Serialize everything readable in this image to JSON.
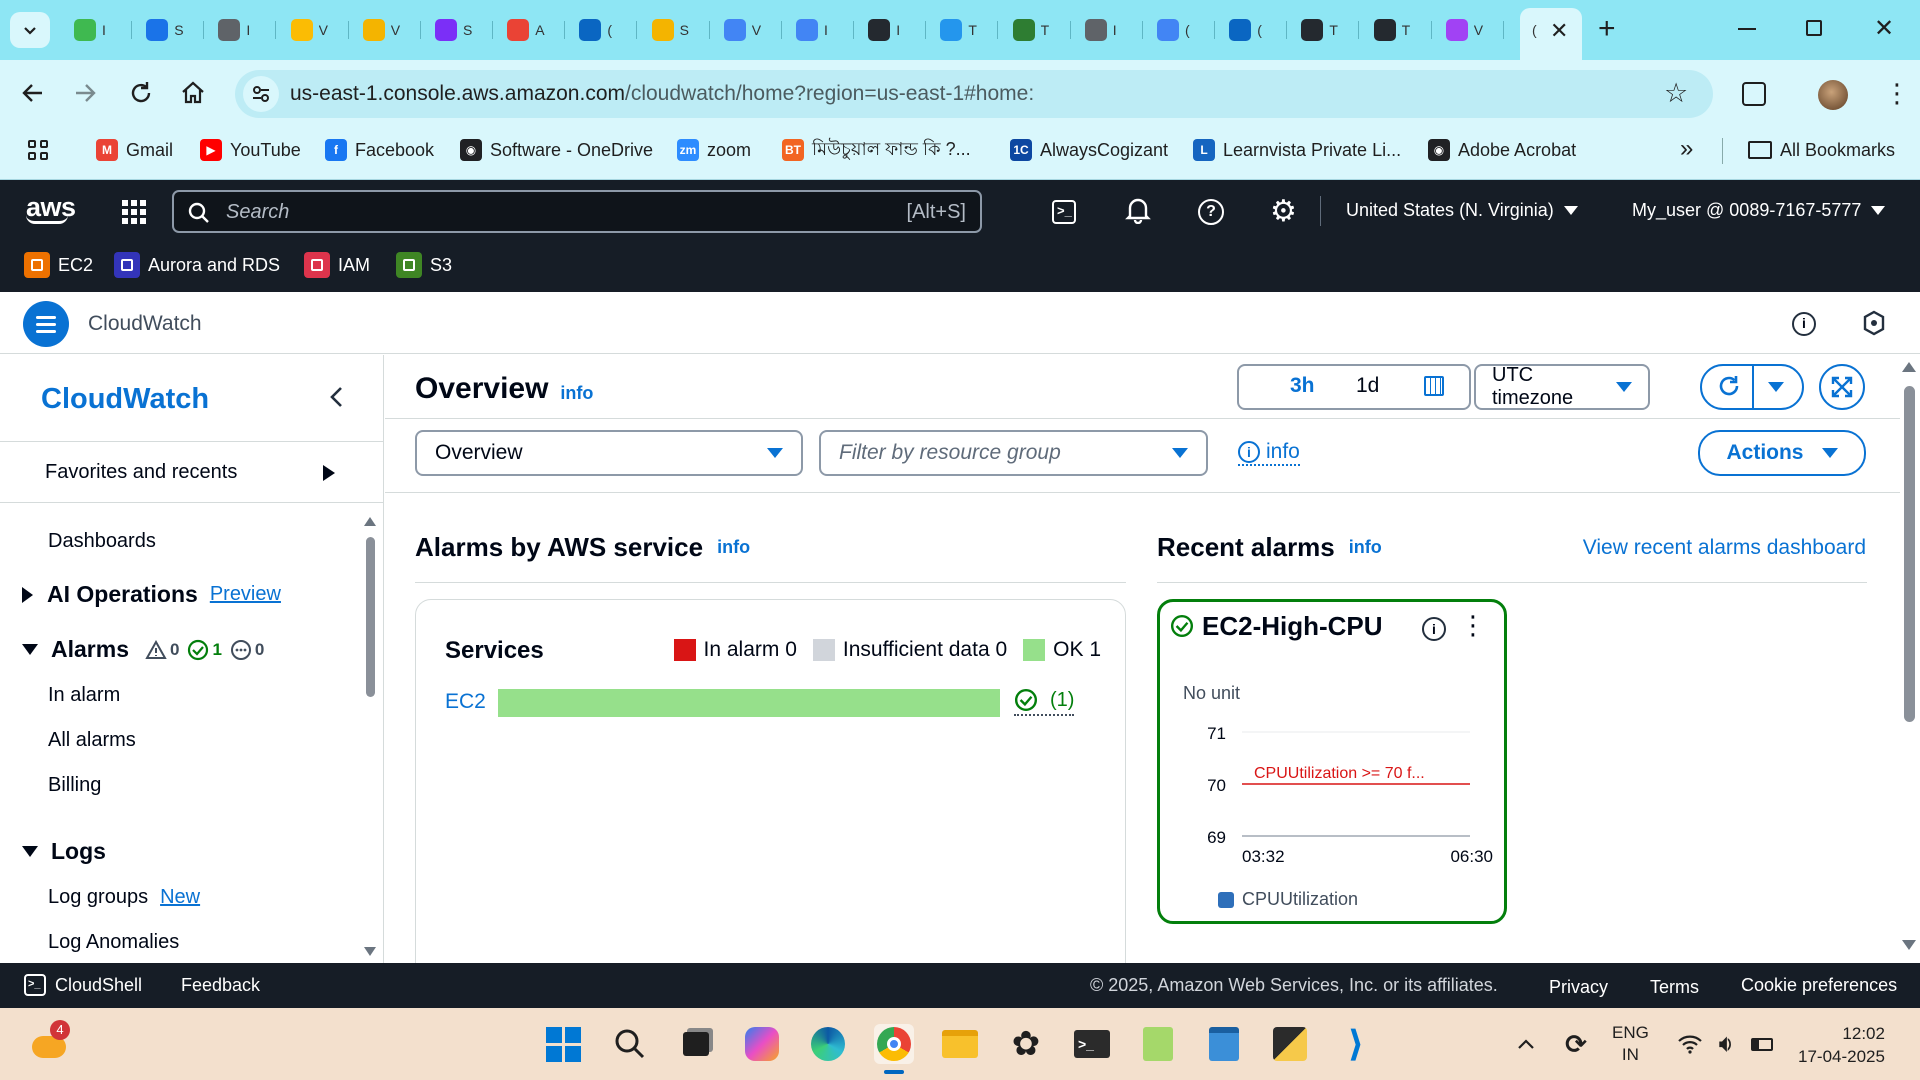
{
  "browser": {
    "tabs": [
      {
        "title": "I",
        "icon": "tab-favicon",
        "color": "#3fb950"
      },
      {
        "title": "S",
        "icon": "tab-favicon",
        "color": "#1a73e8"
      },
      {
        "title": "I",
        "icon": "globe-icon",
        "color": "#5f6368"
      },
      {
        "title": "V",
        "icon": "google-drive-icon",
        "color": "#fbbc04"
      },
      {
        "title": "V",
        "icon": "tab-favicon",
        "color": "#f4b400"
      },
      {
        "title": "S",
        "icon": "tab-favicon",
        "color": "#7b2ff7"
      },
      {
        "title": "A",
        "icon": "gmail-icon",
        "color": "#ea4335"
      },
      {
        "title": "(",
        "icon": "linkedin-icon",
        "color": "#0a66c2"
      },
      {
        "title": "S",
        "icon": "tab-favicon",
        "color": "#f4b400"
      },
      {
        "title": "V",
        "icon": "globe-icon",
        "color": "#4285f4"
      },
      {
        "title": "I",
        "icon": "google-icon",
        "color": "#4285f4"
      },
      {
        "title": "I",
        "icon": "github-icon",
        "color": "#24292f"
      },
      {
        "title": "T",
        "icon": "docker-icon",
        "color": "#2496ed"
      },
      {
        "title": "T",
        "icon": "tab-favicon",
        "color": "#2e7d32"
      },
      {
        "title": "I",
        "icon": "globe-icon",
        "color": "#5f6368"
      },
      {
        "title": "(",
        "icon": "docs-icon",
        "color": "#4285f4"
      },
      {
        "title": "(",
        "icon": "linkedin-icon",
        "color": "#0a66c2"
      },
      {
        "title": "T",
        "icon": "github-icon",
        "color": "#24292f"
      },
      {
        "title": "T",
        "icon": "github-icon",
        "color": "#24292f"
      },
      {
        "title": "V",
        "icon": "tab-favicon",
        "color": "#a142f4"
      }
    ],
    "active_tab_title": "(",
    "url_domain": "us-east-1.console.aws.amazon.com",
    "url_path": "/cloudwatch/home?region=us-east-1#home:",
    "bookmarks": [
      {
        "label": "Gmail",
        "icon": "gmail-icon",
        "color": "#ea4335",
        "glyph": "M"
      },
      {
        "label": "YouTube",
        "icon": "youtube-icon",
        "color": "#ff0000",
        "glyph": "▶"
      },
      {
        "label": "Facebook",
        "icon": "facebook-icon",
        "color": "#1877f2",
        "glyph": "f"
      },
      {
        "label": "Software - OneDrive",
        "icon": "globe-icon",
        "color": "#202124",
        "glyph": "◉"
      },
      {
        "label": "zoom",
        "icon": "zoom-icon",
        "color": "#2d8cff",
        "glyph": "zm"
      },
      {
        "label": "মিউচুয়াল ফান্ড কি ?...",
        "icon": "bt-icon",
        "color": "#f26522",
        "glyph": "BT"
      },
      {
        "label": "AlwaysCogizant",
        "icon": "1c-icon",
        "color": "#0d47a1",
        "glyph": "1C"
      },
      {
        "label": "Learnvista Private Li...",
        "icon": "learnvista-icon",
        "color": "#1565c0",
        "glyph": "L"
      },
      {
        "label": "Adobe Acrobat",
        "icon": "globe-icon",
        "color": "#202124",
        "glyph": "◉"
      }
    ],
    "all_bookmarks": "All Bookmarks"
  },
  "aws": {
    "search_placeholder": "Search",
    "search_shortcut": "[Alt+S]",
    "region": "United States (N. Virginia)",
    "account": "My_user @ 0089-7167-5777",
    "favorites": [
      {
        "label": "EC2",
        "color": "#ed7100"
      },
      {
        "label": "Aurora and RDS",
        "color": "#3334b9"
      },
      {
        "label": "IAM",
        "color": "#dd344c"
      },
      {
        "label": "S3",
        "color": "#3f8624"
      }
    ],
    "service_name": "CloudWatch"
  },
  "sidebar": {
    "title": "CloudWatch",
    "favorites": "Favorites and recents",
    "dashboards": "Dashboards",
    "ai_ops": "AI Operations",
    "ai_ops_badge": "Preview",
    "alarms": "Alarms",
    "alarm_counts": {
      "in_alarm": "0",
      "ok": "1",
      "insufficient": "0"
    },
    "alarm_items": [
      "In alarm",
      "All alarms",
      "Billing"
    ],
    "logs": "Logs",
    "log_groups": "Log groups",
    "log_groups_badge": "New",
    "log_anomalies": "Log Anomalies"
  },
  "main": {
    "title": "Overview",
    "info": "info",
    "time_3h": "3h",
    "time_1d": "1d",
    "timezone": "UTC timezone",
    "overview_select": "Overview",
    "filter_placeholder": "Filter by resource group",
    "actions": "Actions",
    "alarms_by_service": {
      "title": "Alarms by AWS service",
      "services_label": "Services",
      "legend": [
        {
          "label": "In alarm 0",
          "color": "#d91515"
        },
        {
          "label": "Insufficient data 0",
          "color": "#d1d5db"
        },
        {
          "label": "OK 1",
          "color": "#96e08b"
        }
      ],
      "rows": [
        {
          "service": "EC2",
          "ok_count": "(1)",
          "ok_fraction": 1.0
        }
      ]
    },
    "recent_alarms": {
      "title": "Recent alarms",
      "view_link": "View recent alarms dashboard",
      "card": {
        "name": "EC2-High-CPU",
        "unit": "No unit",
        "y_ticks": [
          "71",
          "70",
          "69"
        ],
        "threshold_label": "CPUUtilization >= 70 f...",
        "x_ticks": [
          "03:32",
          "06:30"
        ],
        "legend": "CPUUtilization",
        "legend_color": "#2e6fba"
      }
    }
  },
  "footer": {
    "cloudshell": "CloudShell",
    "feedback": "Feedback",
    "copyright": "© 2025, Amazon Web Services, Inc. or its affiliates.",
    "privacy": "Privacy",
    "terms": "Terms",
    "cookies": "Cookie preferences"
  },
  "taskbar": {
    "weather_badge": "4",
    "lang_line1": "ENG",
    "lang_line2": "IN",
    "time": "12:02",
    "date": "17-04-2025"
  }
}
